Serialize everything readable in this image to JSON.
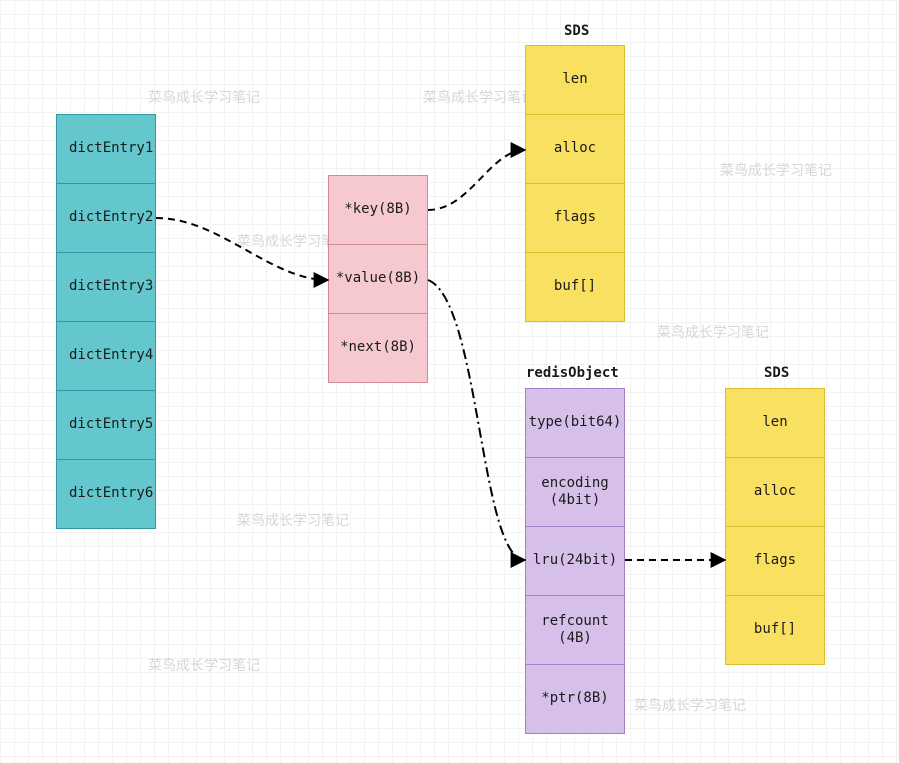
{
  "watermarks": {
    "text": "菜鸟成长学习笔记",
    "positions_note": "six light-grey watermark texts scattered across canvas"
  },
  "dictEntries": {
    "items": [
      {
        "label": "dictEntry1"
      },
      {
        "label": "dictEntry2"
      },
      {
        "label": "dictEntry3"
      },
      {
        "label": "dictEntry4"
      },
      {
        "label": "dictEntry5"
      },
      {
        "label": "dictEntry6"
      }
    ]
  },
  "entryFields": {
    "items": [
      {
        "label": "*key(8B)"
      },
      {
        "label": "*value(8B)"
      },
      {
        "label": "*next(8B)"
      }
    ]
  },
  "sds": {
    "title": "SDS",
    "items": [
      {
        "label": "len"
      },
      {
        "label": "alloc"
      },
      {
        "label": "flags"
      },
      {
        "label": "buf[]"
      }
    ]
  },
  "redisObject": {
    "title": "redisObject",
    "items": [
      {
        "label": "type(bit64)"
      },
      {
        "label": "encoding\n(4bit)"
      },
      {
        "label": "lru(24bit)"
      },
      {
        "label": "refcount\n(4B)"
      },
      {
        "label": "*ptr(8B)"
      }
    ]
  },
  "sds2": {
    "title": "SDS",
    "items": [
      {
        "label": "len"
      },
      {
        "label": "alloc"
      },
      {
        "label": "flags"
      },
      {
        "label": "buf[]"
      }
    ]
  },
  "arrows": [
    {
      "from": "dictEntry2",
      "to": "entryFields.*value",
      "style": "dashed"
    },
    {
      "from": "entryFields.*key",
      "to": "sds.alloc",
      "style": "dashed"
    },
    {
      "from": "entryFields.*value",
      "to": "redisObject.lru",
      "style": "dash-dot"
    },
    {
      "from": "redisObject.lru",
      "to": "sds2.flags",
      "style": "dashed"
    }
  ],
  "colors": {
    "teal_fill": "#65c7ce",
    "teal_border": "#2c9aa1",
    "pink_fill": "#f6c9d0",
    "pink_border": "#d28a96",
    "yellow_fill": "#fae060",
    "yellow_border": "#d9bf2f",
    "purple_fill": "#d6bfe9",
    "purple_border": "#a581c4",
    "watermark": "#d7d7d7",
    "grid": "#f2f2f2"
  }
}
